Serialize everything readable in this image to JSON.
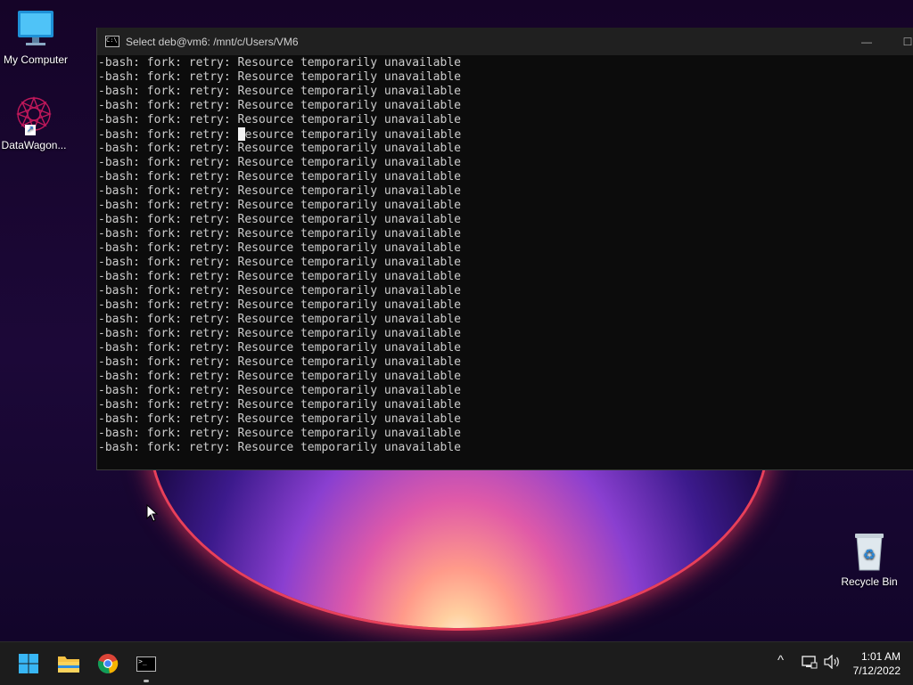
{
  "desktop": {
    "icons": [
      {
        "label": "My Computer"
      },
      {
        "label": "DataWagon..."
      },
      {
        "label": "Recycle Bin"
      }
    ]
  },
  "terminal": {
    "title": "Select deb@vm6: /mnt/c/Users/VM6",
    "lines": [
      "-bash: fork: retry: Resource temporarily unavailable",
      "-bash: fork: retry: Resource temporarily unavailable",
      "-bash: fork: retry: Resource temporarily unavailable",
      "-bash: fork: retry: Resource temporarily unavailable",
      "-bash: fork: retry: Resource temporarily unavailable",
      "-bash: fork: retry: Resource temporarily unavailable",
      "-bash: fork: retry: Resource temporarily unavailable",
      "-bash: fork: retry: Resource temporarily unavailable",
      "-bash: fork: retry: Resource temporarily unavailable",
      "-bash: fork: retry: Resource temporarily unavailable",
      "-bash: fork: retry: Resource temporarily unavailable",
      "-bash: fork: retry: Resource temporarily unavailable",
      "-bash: fork: retry: Resource temporarily unavailable",
      "-bash: fork: retry: Resource temporarily unavailable",
      "-bash: fork: retry: Resource temporarily unavailable",
      "-bash: fork: retry: Resource temporarily unavailable",
      "-bash: fork: retry: Resource temporarily unavailable",
      "-bash: fork: retry: Resource temporarily unavailable",
      "-bash: fork: retry: Resource temporarily unavailable",
      "-bash: fork: retry: Resource temporarily unavailable",
      "-bash: fork: retry: Resource temporarily unavailable",
      "-bash: fork: retry: Resource temporarily unavailable",
      "-bash: fork: retry: Resource temporarily unavailable",
      "-bash: fork: retry: Resource temporarily unavailable",
      "-bash: fork: retry: Resource temporarily unavailable",
      "-bash: fork: retry: Resource temporarily unavailable",
      "-bash: fork: retry: Resource temporarily unavailable",
      "-bash: fork: retry: Resource temporarily unavailable"
    ],
    "selection_cursor": {
      "line": 5,
      "column": 20
    },
    "minimize_glyph": "—",
    "maximize_glyph": "☐"
  },
  "taskbar": {
    "apps": [
      {
        "icon": "windows-start-icon"
      },
      {
        "icon": "file-explorer-icon"
      },
      {
        "icon": "chrome-icon"
      },
      {
        "icon": "terminal-icon",
        "active": true
      }
    ],
    "tray": {
      "chevron": "^",
      "network_icon": "network-icon",
      "volume_icon": "volume-icon"
    },
    "clock": {
      "time": "1:01 AM",
      "date": "7/12/2022"
    }
  },
  "colors": {
    "terminal_bg": "#0c0c0c",
    "terminal_text": "#cccccc",
    "taskbar_bg": "#1c1c1c",
    "accent_glow": "#e8405a"
  }
}
